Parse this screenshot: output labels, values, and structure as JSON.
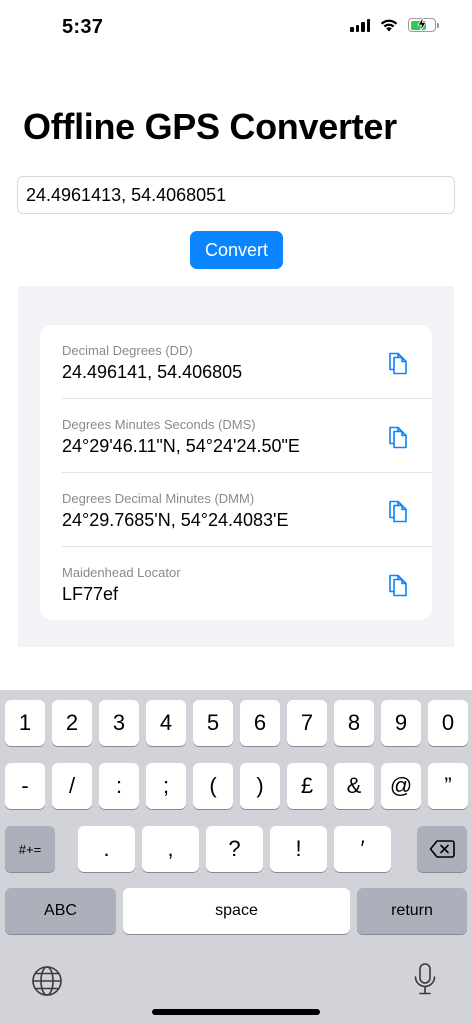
{
  "status_bar": {
    "time": "5:37",
    "battery_level": 0.58,
    "battery_color": "#34c759"
  },
  "app": {
    "title": "Offline GPS Converter"
  },
  "input": {
    "value": "24.4961413, 54.4068051"
  },
  "convert_button": {
    "label": "Convert",
    "color": "#0a84ff"
  },
  "results": [
    {
      "label": "Decimal Degrees (DD)",
      "value": "24.496141, 54.406805",
      "icon": "copy-icon"
    },
    {
      "label": "Degrees Minutes Seconds (DMS)",
      "value": "24°29'46.11\"N, 54°24'24.50\"E",
      "icon": "copy-icon"
    },
    {
      "label": "Degrees Decimal Minutes (DMM)",
      "value": "24°29.7685'N, 54°24.4083'E",
      "icon": "copy-icon"
    },
    {
      "label": "Maidenhead Locator",
      "value": "LF77ef",
      "icon": "copy-icon"
    }
  ],
  "keyboard": {
    "row1": [
      "1",
      "2",
      "3",
      "4",
      "5",
      "6",
      "7",
      "8",
      "9",
      "0"
    ],
    "row2": [
      "-",
      "/",
      ":",
      ";",
      "(",
      ")",
      "£",
      "&",
      "@",
      "”"
    ],
    "row3": {
      "shift_label": "#+=",
      "keys": [
        ".",
        ",",
        "?",
        "!",
        "′"
      ],
      "delete_icon": "backspace-icon"
    },
    "row4": {
      "abc_label": "ABC",
      "space_label": "space",
      "return_label": "return"
    },
    "globe_icon": "globe-icon",
    "mic_icon": "microphone-icon"
  }
}
